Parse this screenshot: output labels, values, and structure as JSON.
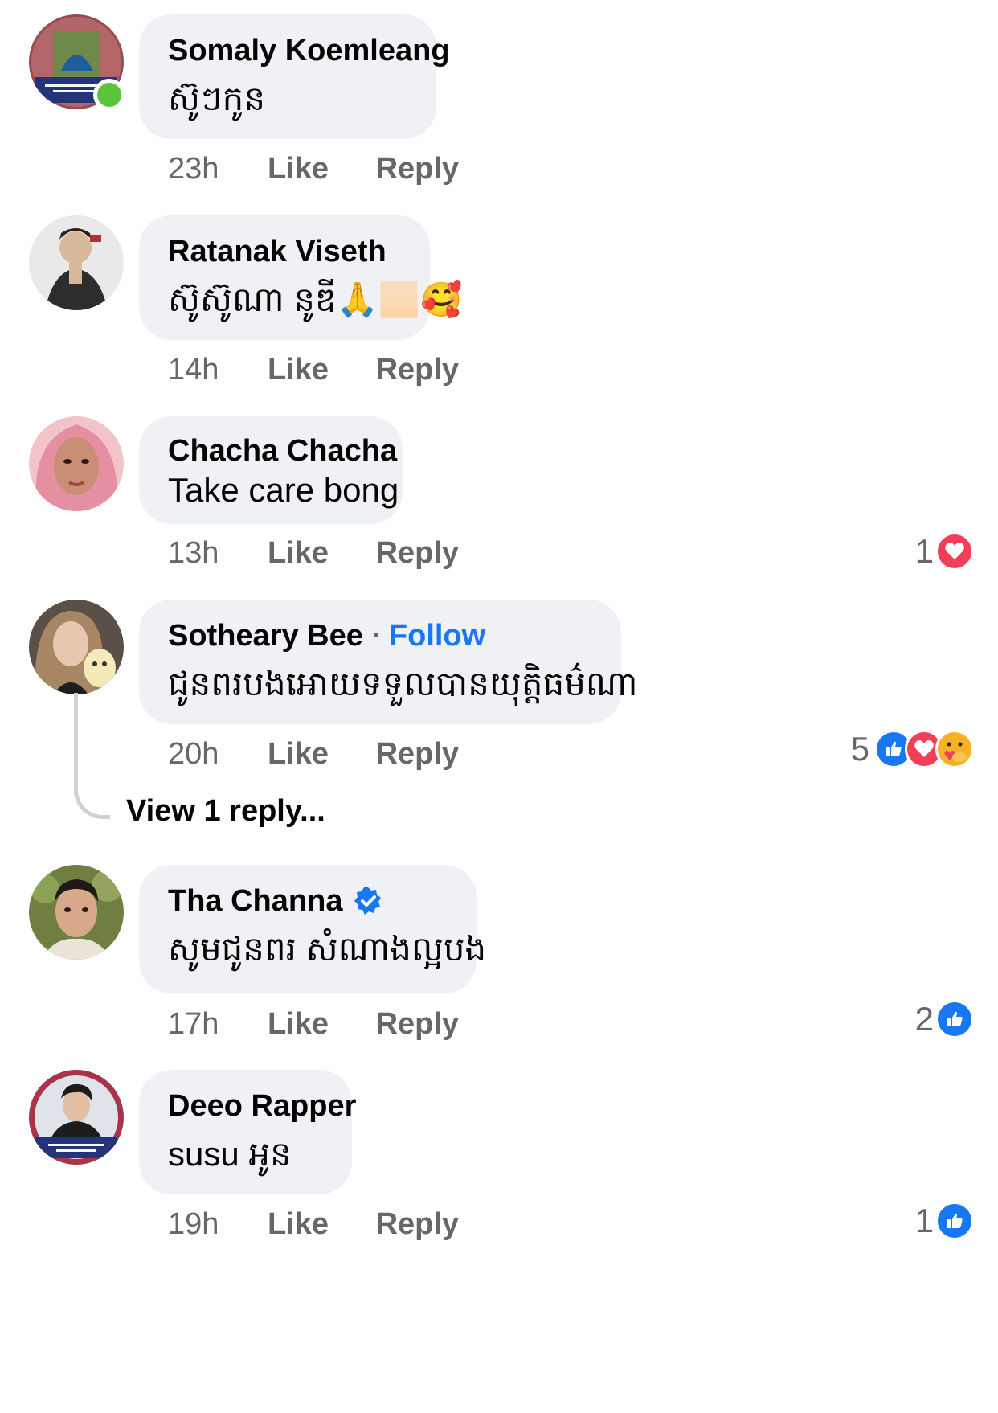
{
  "comments": [
    {
      "author": "Somaly Koemleang",
      "text": "ស៊ូៗកូន",
      "time": "23h",
      "like_label": "Like",
      "reply_label": "Reply",
      "online": true,
      "reaction_count": "",
      "reactions": []
    },
    {
      "author": "Ratanak Viseth",
      "text": "ស៊ូស៊ូណា នូឌី🙏🏻🥰",
      "time": "14h",
      "like_label": "Like",
      "reply_label": "Reply",
      "reaction_count": "",
      "reactions": []
    },
    {
      "author": "Chacha Chacha",
      "text": "Take care bong",
      "time": "13h",
      "like_label": "Like",
      "reply_label": "Reply",
      "reaction_count": "1",
      "reactions": [
        "love-icon"
      ]
    },
    {
      "author": "Sotheary Bee",
      "separator": "·",
      "follow_label": "Follow",
      "text": "ជូនពរបងអោយទទួលបានយុត្តិធម៌ណា",
      "time": "20h",
      "like_label": "Like",
      "reply_label": "Reply",
      "reaction_count": "5",
      "reactions": [
        "like-icon",
        "love-icon",
        "care-icon"
      ],
      "view_replies_label": "View 1 reply..."
    },
    {
      "author": "Tha Channa",
      "verified": true,
      "text": "សូមជូនពរ សំណាងល្អបង",
      "time": "17h",
      "like_label": "Like",
      "reply_label": "Reply",
      "reaction_count": "2",
      "reactions": [
        "like-icon"
      ]
    },
    {
      "author": "Deeo Rapper",
      "text": "susu អូន",
      "time": "19h",
      "like_label": "Like",
      "reply_label": "Reply",
      "reaction_count": "1",
      "reactions": [
        "like-icon"
      ]
    }
  ],
  "colors": {
    "bubble": "#f0f1f5",
    "link_blue": "#1877f2",
    "meta_gray": "#65676b",
    "online_green": "#5ac43b",
    "love_red": "#f33e58"
  }
}
